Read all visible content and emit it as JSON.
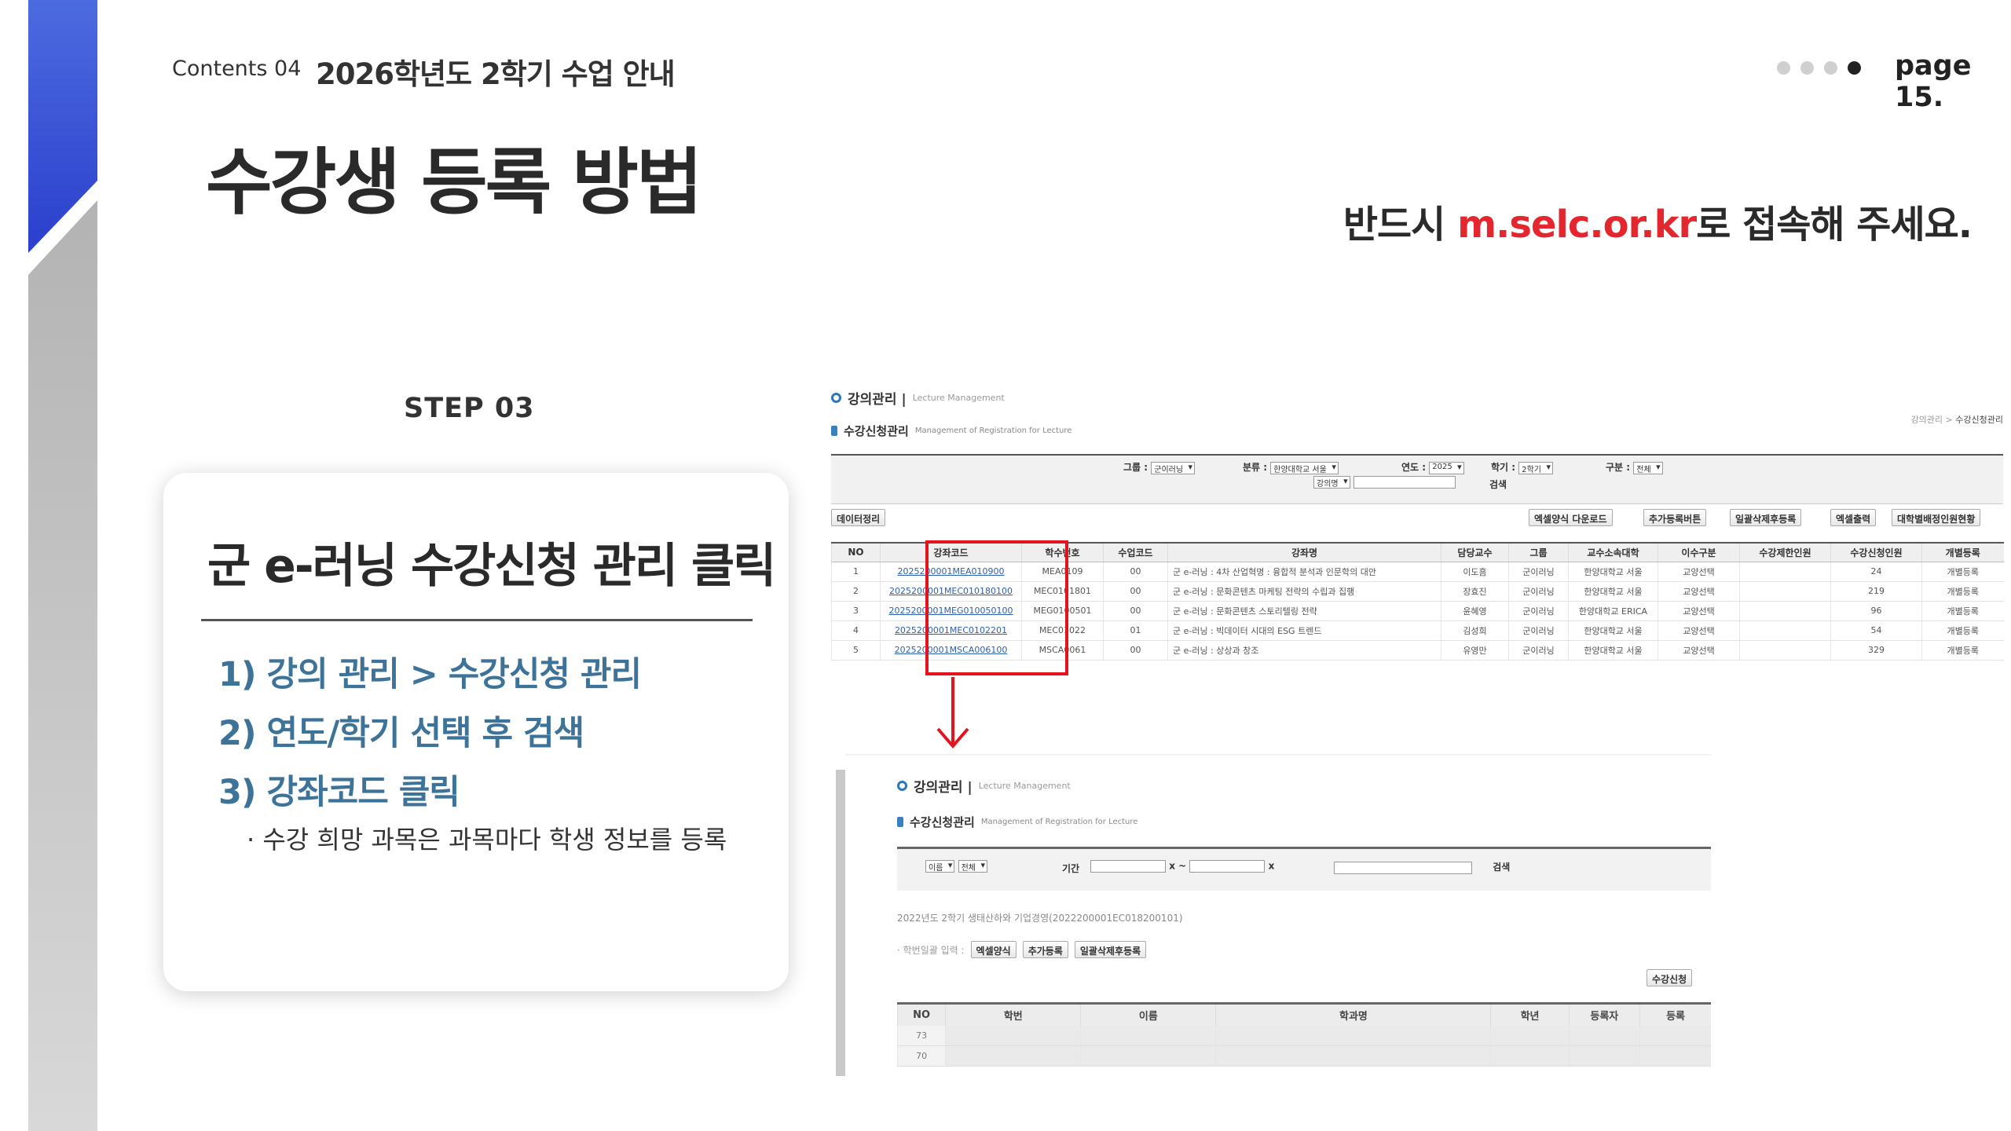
{
  "header": {
    "contents_label": "Contents 04",
    "section_title": "2026학년도 2학기 수업 안내",
    "page_label": "page 15.",
    "page_dots": 4,
    "active_dot": 4
  },
  "main_title": "수강생 등록 방법",
  "notice": {
    "prefix": "반드시 ",
    "url": "m.selc.or.kr",
    "suffix": "로 접속해 주세요."
  },
  "step_label": "STEP 03",
  "card": {
    "title": "군 e-러닝 수강신청 관리 클릭",
    "items": [
      "1) 강의 관리 > 수강신청 관리",
      "2) 연도/학기 선택 후 검색",
      "3) 강좌코드 클릭"
    ],
    "note": "· 수강 희망 과목은 과목마다 학생 정보를 등록"
  },
  "screenshot1": {
    "heading": "강의관리 |",
    "heading_en": "Lecture Management",
    "subheading": "수강신청관리",
    "subheading_en": "Management of Registration for Lecture",
    "breadcrumb_prefix": "강의관리 > ",
    "breadcrumb_current": "수강신청관리",
    "filter": {
      "group_label": "그룹 :",
      "group_value": "군이러닝",
      "category_label": "분류 :",
      "category_value": "한양대학교 서울",
      "year_label": "연도 :",
      "year_value": "2025",
      "semester_label": "학기 :",
      "semester_value": "2학기",
      "type_label": "구분 :",
      "type_value": "전체",
      "course_select": "강의명",
      "search_button": "검색"
    },
    "left_button": "데이터정리",
    "buttons": [
      "엑셀양식 다운로드",
      "추가등록버튼",
      "일괄삭제후등록",
      "엑셀출력",
      "대학별배정인원현황"
    ],
    "columns": [
      "NO",
      "강좌코드",
      "학수번호",
      "수업코드",
      "강좌명",
      "담당교수",
      "그룹",
      "교수소속대학",
      "이수구분",
      "수강제한인원",
      "수강신청인원",
      "개별등록"
    ],
    "rows": [
      [
        "1",
        "2025200001MEA010900",
        "MEA0109",
        "00",
        "군 e-러닝 : 4차 산업혁명 : 융합적 분석과 인문학의 대안",
        "이도흠",
        "군이러닝",
        "한양대학교 서울",
        "교양선택",
        "",
        "24",
        "개별등록"
      ],
      [
        "2",
        "2025200001MEC010180100",
        "MEC0101801",
        "00",
        "군 e-러닝 : 문화콘텐츠 마케팅 전략의 수립과 집행",
        "장효진",
        "군이러닝",
        "한양대학교 서울",
        "교양선택",
        "",
        "219",
        "개별등록"
      ],
      [
        "3",
        "2025200001MEG010050100",
        "MEG0100501",
        "00",
        "군 e-러닝 : 문화콘텐츠 스토리텔링 전략",
        "윤혜영",
        "군이러닝",
        "한양대학교 ERICA",
        "교양선택",
        "",
        "96",
        "개별등록"
      ],
      [
        "4",
        "2025200001MEC0102201",
        "MEC01022",
        "01",
        "군 e-러닝 : 빅데이터 시대의 ESG 트렌드",
        "김성희",
        "군이러닝",
        "한양대학교 서울",
        "교양선택",
        "",
        "54",
        "개별등록"
      ],
      [
        "5",
        "2025200001MSCA006100",
        "MSCA0061",
        "00",
        "군 e-러닝 : 상상과 창조",
        "유영만",
        "군이러닝",
        "한양대학교 서울",
        "교양선택",
        "",
        "329",
        "개별등록"
      ]
    ]
  },
  "screenshot2": {
    "heading": "강의관리 |",
    "heading_en": "Lecture Management",
    "subheading": "수강신청관리",
    "subheading_en": "Management of Registration for Lecture",
    "filter_select1": "이름",
    "filter_select2": "전체",
    "period_label": "기간",
    "x1": "x",
    "dash": "~",
    "x2": "x",
    "search_button": "검색",
    "info_text": "2022년도 2학기 생태산하와 기업경영(2022200001EC018200101)",
    "bulk_label": "· 학번일괄 입력 :",
    "bulk_buttons": [
      "엑셀양식",
      "추가등록",
      "일괄삭제후등록"
    ],
    "right_button": "수강신청",
    "columns": [
      "NO",
      "학번",
      "이름",
      "학과명",
      "학년",
      "등록자",
      "등록"
    ],
    "rows": [
      "73",
      "70"
    ]
  },
  "colors": {
    "accent_red": "#e4262f",
    "item_blue": "#3d7299",
    "stripe_blue": "#3450d6",
    "stripe_gray": "#b8b8b8",
    "highlight_box": "#e3141d"
  }
}
